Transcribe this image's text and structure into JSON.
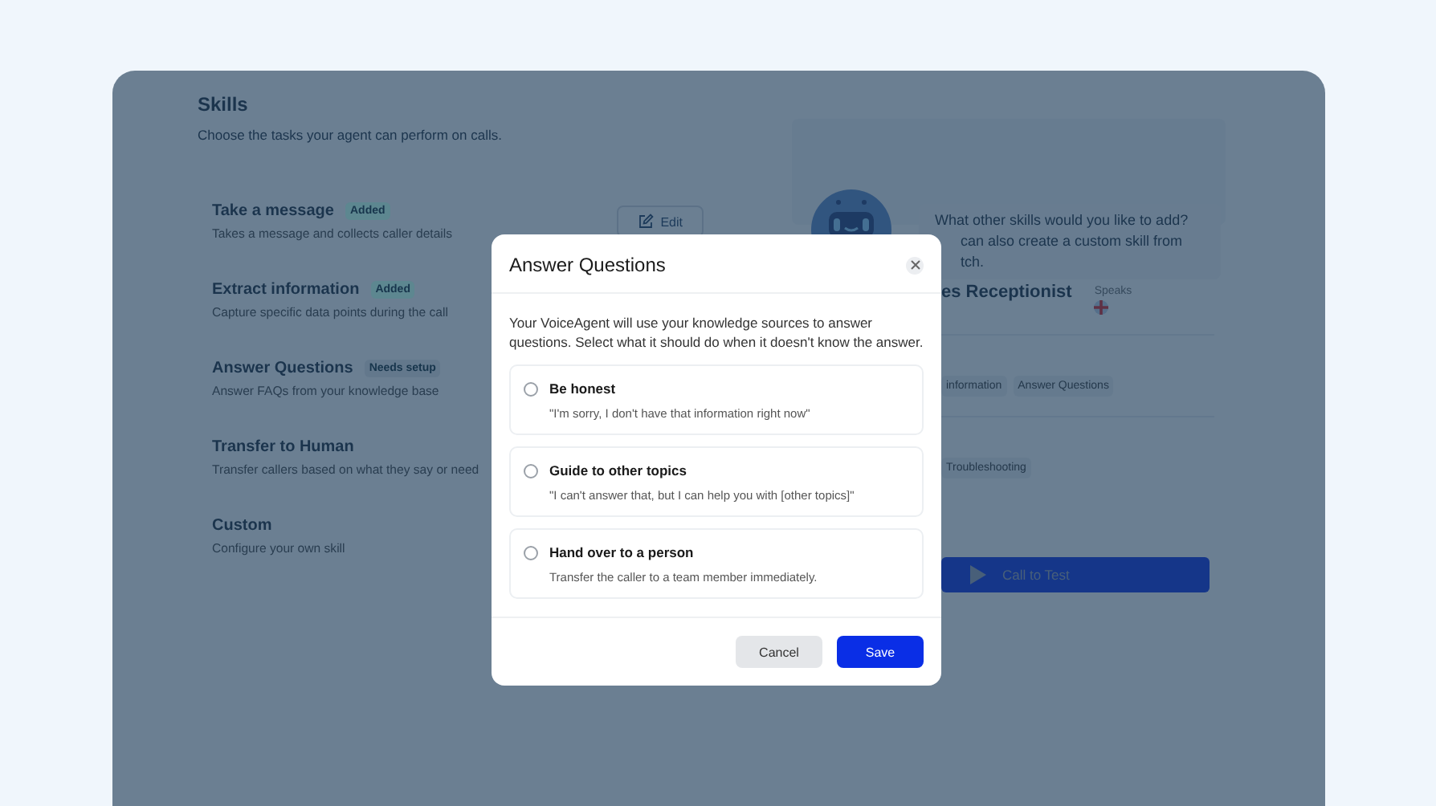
{
  "skills": {
    "title": "Skills",
    "subtitle": "Choose the tasks your agent can perform on calls.",
    "items": [
      {
        "name": "Take a message",
        "badge": {
          "label": "Added",
          "color": "#5d8790"
        },
        "description": "Takes a message and collects caller details",
        "action": "Edit"
      },
      {
        "name": "Extract information",
        "badge": {
          "label": "Added",
          "color": "#5d8790"
        },
        "description": "Capture specific data points during the call"
      },
      {
        "name": "Answer Questions",
        "badge": {
          "label": "Needs setup",
          "color": "#63788c"
        },
        "description": "Answer FAQs from your knowledge base"
      },
      {
        "name": "Transfer to Human",
        "description": "Transfer callers based on what they say or need"
      },
      {
        "name": "Custom",
        "description": "Configure your own skill"
      }
    ]
  },
  "assistant": {
    "bubble_lines": [
      "What other skills would you like to add?",
      "can also create a custom skill from",
      "tch."
    ],
    "agent_name": "es Receptionist",
    "speaks_label": "Speaks",
    "skill_chips": [
      "information",
      "Answer Questions"
    ],
    "topic_chips": [
      "Troubleshooting"
    ],
    "call_button": "Call to Test"
  },
  "modal": {
    "title": "Answer Questions",
    "description": "Your VoiceAgent will use your knowledge sources to answer questions. Select what it should do when it doesn't know the answer.",
    "options": [
      {
        "title": "Be honest",
        "description": "\"I'm sorry, I don't have that information right now\"",
        "selected": false
      },
      {
        "title": "Guide to other topics",
        "description": "\"I can't answer that, but I can help you with [other topics]\"",
        "selected": false
      },
      {
        "title": "Hand over to a person",
        "description": "Transfer the caller to a team member immediately.",
        "selected": false
      }
    ],
    "cancel": "Cancel",
    "save": "Save"
  }
}
